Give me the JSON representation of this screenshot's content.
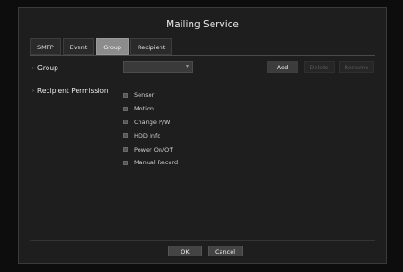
{
  "dialog": {
    "title": "Mailing Service"
  },
  "tabs": [
    {
      "label": "SMTP"
    },
    {
      "label": "Event"
    },
    {
      "label": "Group",
      "active": true
    },
    {
      "label": "Recipient"
    }
  ],
  "group": {
    "label": "Group",
    "select_value": "",
    "buttons": {
      "add": "Add",
      "delete": "Delete",
      "rename": "Rename"
    }
  },
  "recipient_permission": {
    "label": "Recipient Permission",
    "items": [
      "Sensor",
      "Motion",
      "Change P/W",
      "HDD Info",
      "Power On/Off",
      "Manual Record"
    ]
  },
  "footer": {
    "ok": "OK",
    "cancel": "Cancel"
  }
}
